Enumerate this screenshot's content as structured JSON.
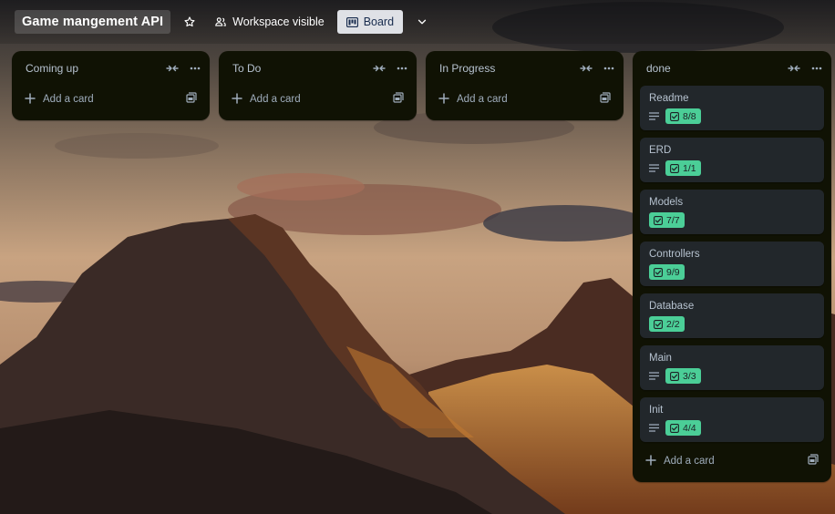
{
  "header": {
    "board_title": "Game mangement API",
    "visibility_label": "Workspace visible",
    "view_label": "Board"
  },
  "add_card_label": "Add a card",
  "lists": [
    {
      "title": "Coming up",
      "cards": []
    },
    {
      "title": "To Do",
      "cards": []
    },
    {
      "title": "In Progress",
      "cards": []
    },
    {
      "title": "done",
      "cards": [
        {
          "title": "Readme",
          "has_description": true,
          "checklist": "8/8"
        },
        {
          "title": "ERD",
          "has_description": true,
          "checklist": "1/1"
        },
        {
          "title": "Models",
          "has_description": false,
          "checklist": "7/7"
        },
        {
          "title": "Controllers",
          "has_description": false,
          "checklist": "9/9"
        },
        {
          "title": "Database",
          "has_description": false,
          "checklist": "2/2"
        },
        {
          "title": "Main",
          "has_description": true,
          "checklist": "3/3"
        },
        {
          "title": "Init",
          "has_description": true,
          "checklist": "4/4"
        }
      ]
    }
  ],
  "colors": {
    "list_bg": "#101204",
    "card_bg": "#22272b",
    "checklist_complete": "#4bce97",
    "view_button_bg": "#dfe1e6"
  },
  "icons": {
    "star": "star-icon",
    "visibility": "people-icon",
    "board_view": "board-icon",
    "chevron": "chevron-down-icon",
    "collapse": "collapse-icon",
    "more": "more-icon",
    "plus": "plus-icon",
    "template": "template-icon",
    "description": "description-icon",
    "checklist": "checklist-icon"
  }
}
